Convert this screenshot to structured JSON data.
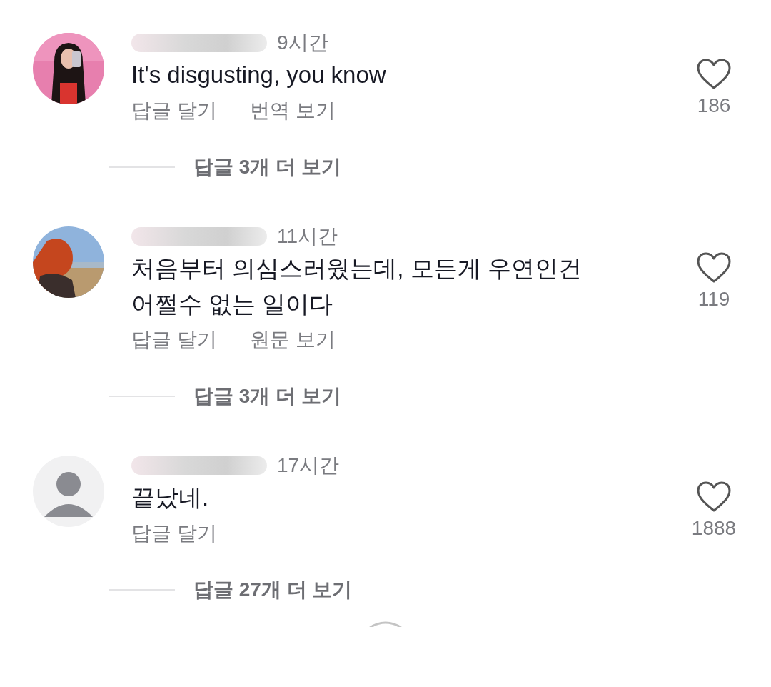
{
  "comments": [
    {
      "avatar": {
        "kind": "picture"
      },
      "time": "9시간",
      "text": "It's disgusting, you know",
      "actions": [
        "답글 달기",
        "번역 보기"
      ],
      "liked": false,
      "likes": "186",
      "more_replies": "답글 3개 더 보기"
    },
    {
      "avatar": {
        "kind": "picture"
      },
      "time": "11시간",
      "text": "처음부터 의심스러웠는데, 모든게 우연인건 어쩔수 없는 일이다",
      "actions": [
        "답글 달기",
        "원문 보기"
      ],
      "liked": false,
      "likes": "119",
      "more_replies": "답글 3개 더 보기"
    },
    {
      "avatar": {
        "kind": "default"
      },
      "time": "17시간",
      "text": "끝났네.",
      "actions": [
        "답글 달기"
      ],
      "liked": false,
      "likes": "1888",
      "more_replies": "답글 27개 더 보기"
    }
  ]
}
